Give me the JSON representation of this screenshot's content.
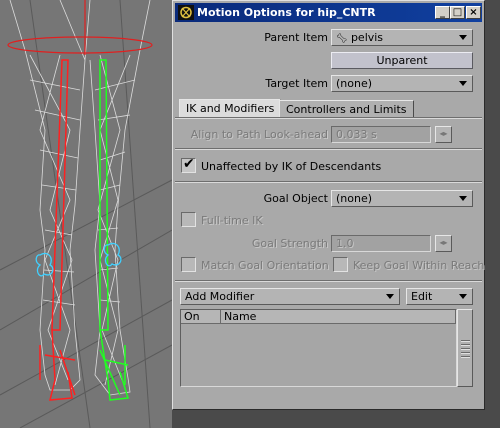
{
  "window": {
    "title": "Motion Options for hip_CNTR",
    "controls": {
      "minimize": "_",
      "maximize": "□",
      "close": "×"
    }
  },
  "parent": {
    "label": "Parent Item",
    "value": "pelvis",
    "icon": "bone-icon",
    "unparent_label": "Unparent"
  },
  "target": {
    "label": "Target Item",
    "value": "(none)"
  },
  "tabs": [
    {
      "label": "IK and Modifiers",
      "active": true
    },
    {
      "label": "Controllers and Limits",
      "active": false
    }
  ],
  "align_path": {
    "label": "Align to Path Look-ahead",
    "value": "0.033 s",
    "enabled": false
  },
  "unaffected_ik": {
    "label": "Unaffected by IK of Descendants",
    "checked": true
  },
  "goal_object": {
    "label": "Goal Object",
    "value": "(none)"
  },
  "fulltime_ik": {
    "label": "Full-time IK",
    "checked": false,
    "enabled": false
  },
  "goal_strength": {
    "label": "Goal Strength",
    "value": "1.0",
    "enabled": false
  },
  "match_goal": {
    "label": "Match Goal Orientation",
    "checked": false,
    "enabled": false
  },
  "keep_goal": {
    "label": "Keep Goal Within Reach",
    "checked": false,
    "enabled": false
  },
  "modifiers": {
    "add_label": "Add Modifier",
    "edit_label": "Edit",
    "columns": [
      "On",
      "Name"
    ],
    "rows": []
  },
  "colors": {
    "title_bar": "#0a2a7a",
    "panel": "#a9a9a9",
    "viewport": "#767676",
    "bone_left": "#ff2020",
    "bone_right": "#20ff20"
  }
}
